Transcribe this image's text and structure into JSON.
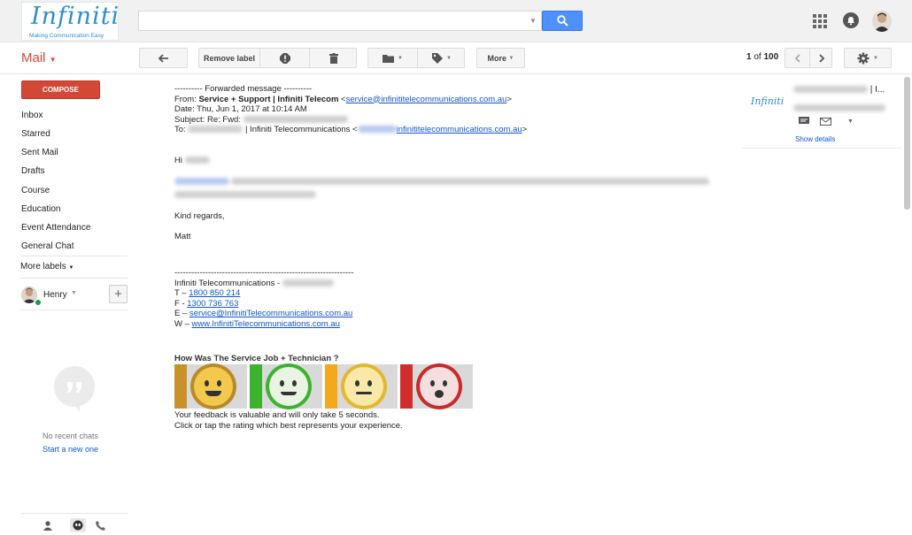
{
  "header": {
    "logo_text": "Infiniti",
    "logo_tagline": "Making Communication Easy",
    "search": {
      "value": "",
      "placeholder": ""
    }
  },
  "toolbar": {
    "mail_label": "Mail",
    "remove_label": "Remove label",
    "more_label": "More",
    "page_current": "1",
    "page_of": "of",
    "page_total": "100"
  },
  "sidebar": {
    "compose_label": "COMPOSE",
    "items": [
      {
        "label": "Inbox"
      },
      {
        "label": "Starred"
      },
      {
        "label": "Sent Mail"
      },
      {
        "label": "Drafts"
      },
      {
        "label": "Course"
      },
      {
        "label": "Education"
      },
      {
        "label": "Event Attendance"
      },
      {
        "label": "General Chat"
      }
    ],
    "more_labels": "More labels",
    "user_name": "Henry",
    "no_chats": "No recent chats",
    "start_chat": "Start a new one"
  },
  "email": {
    "forward_header": "---------- Forwarded message ----------",
    "from_prefix": "From: ",
    "from_name": "Service + Support | Infiniti Telecom",
    "from_email": "service@infinititelecommunications.com.au",
    "date_line": "Date: Thu, Jun 1, 2017 at 10:14 AM",
    "subject_prefix": "Subject: Re: Fwd: ",
    "to_prefix": "To: ",
    "to_company": " | Infiniti Telecommunications <",
    "to_email_domain": "infinititelecommunications.com.au",
    "greeting": "Hi",
    "closing": "Kind regards,",
    "signer": "Matt",
    "sig_divider": "----------------------------------------------------------------",
    "sig_company": "Infiniti Telecommunications -",
    "sig_t_prefix": "T – ",
    "sig_t": "1800 850 214",
    "sig_f_prefix": "F - ",
    "sig_f": "1300  736 763",
    "sig_e_prefix": "E – ",
    "sig_e": "service@InfinitiTelecommunications.com.au",
    "sig_w_prefix": "W –  ",
    "sig_w": "www.InfinitiTelecommunications.com.au",
    "rating_title": "How Was The Service Job + Technician ?",
    "feedback_line1": "Your feedback is valuable and will only take 5 seconds.",
    "feedback_line2": "Click or tap the rating which best represents your experience.",
    "ratings": [
      {
        "color": "#c8912b",
        "face": "#f2c94c"
      },
      {
        "color": "#3cb32f",
        "face": "#e9f5e2"
      },
      {
        "color": "#f4a91a",
        "face": "#f8e9a8"
      },
      {
        "color": "#d22d2d",
        "face": "#f5dede"
      }
    ]
  },
  "contact_panel": {
    "logo_text": "Infiniti",
    "name_suffix": " | I...",
    "show_details": "Show details"
  },
  "colors": {
    "accent_red": "#d14836",
    "search_blue": "#4d90fe",
    "link_blue": "#1155cc",
    "presence_green": "#0f9d58"
  }
}
